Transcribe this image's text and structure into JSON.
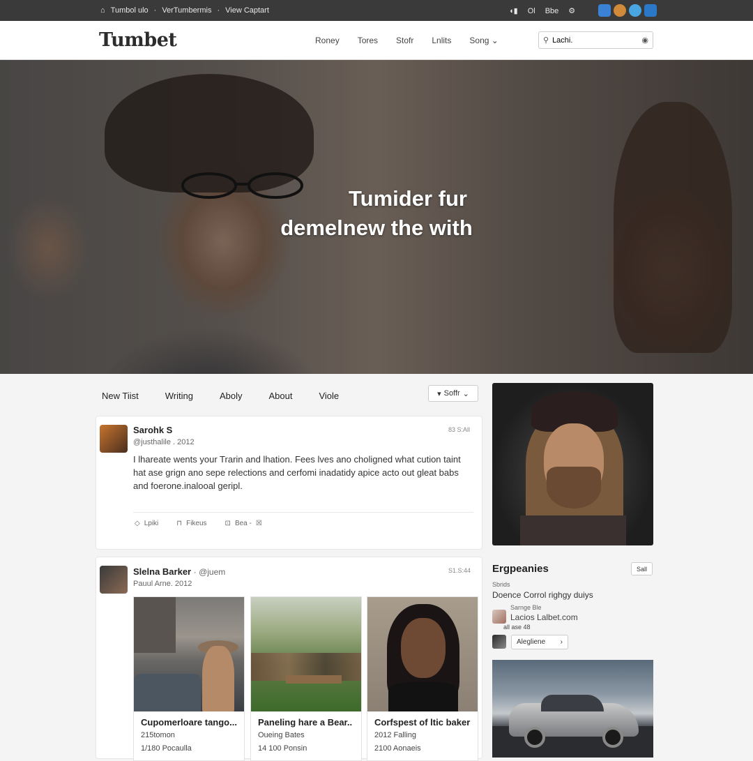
{
  "sysbar": {
    "left_items": [
      "Tumbol ulo",
      "VerTumbermis",
      "View Captart"
    ],
    "right_items": [
      "Ol",
      "Bbe"
    ]
  },
  "header": {
    "logo": "Tumbet",
    "nav": [
      "Roney",
      "Tores",
      "Stofr",
      "Lnlits",
      "Song"
    ],
    "search_value": "Lachi."
  },
  "hero": {
    "line1": "Tumider fur",
    "line2": "demelnew the with"
  },
  "tabs": [
    "New Tiist",
    "Writing",
    "Aboly",
    "About",
    "Viole"
  ],
  "sort_label": "Soffr",
  "post1": {
    "author": "Sarohk S",
    "handle": "@justhalile . 2012",
    "stamp": "83 S:All",
    "text": "I lhareate wents your Trarin and lhation. Fees lves ano choligned what cution taint hat ase grign ano sepe relections and cerfomi inadatidy apice acto out gleat babs and foerone.inalooal geripl.",
    "actions": [
      "Lpiki",
      "Fikeus",
      "Bea -"
    ]
  },
  "post2": {
    "author": "Slelna Barker",
    "handle_inline": "· @juem",
    "handle": "Pauul Arne. 2012",
    "stamp": "S1.S:44",
    "tiles": [
      {
        "title": "Cupomerloare tango...",
        "sub1": "215tomon",
        "sub2": "1/180 Pocaulla"
      },
      {
        "title": "Paneling hare a Bear..",
        "sub1": "Oueing Bates",
        "sub2": "14 100 Ponsin"
      },
      {
        "title": "Corfspest of ltic baker",
        "sub1": "2012 Falling",
        "sub2": "2100 Aonaeis"
      }
    ]
  },
  "sidebar": {
    "title": "Ergpeanies",
    "btn": "Sall",
    "sub": "Sbrids",
    "desc": "Doence Corrol righgy duiys",
    "row1": "Sarnge Ble",
    "row2": "Lacios Lalbet.com",
    "row3": "all ase 48",
    "follow": "Alegliene"
  },
  "colors": {
    "sysbar": "#3a3a3a",
    "header": "#ffffff",
    "page": "#f4f4f4"
  }
}
